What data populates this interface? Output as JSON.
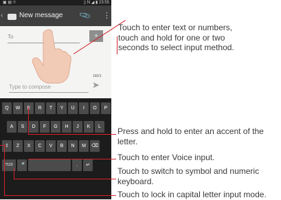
{
  "status_bar": {
    "left_icons": "▣ ▤ ⟐",
    "right_text": "▯ N ◢ ▮ 23:55"
  },
  "action_bar": {
    "title": "New message",
    "back_glyph": "‹",
    "attach_glyph": "📎",
    "menu_glyph": "⋮",
    "icons": [
      "back-icon",
      "message-icon",
      "attach-icon",
      "overflow-menu-icon"
    ]
  },
  "compose": {
    "to_placeholder": "To",
    "contact_glyph": "+",
    "counter": "160/1",
    "body_placeholder": "Type to compose",
    "send_glyph": "➤"
  },
  "keyboard": {
    "row1": [
      "Q",
      "W",
      "E",
      "R",
      "T",
      "Y",
      "U",
      "I",
      "O",
      "P"
    ],
    "row2": [
      "A",
      "S",
      "D",
      "F",
      "G",
      "H",
      "J",
      "K",
      "L"
    ],
    "row3": [
      "⇧",
      "Z",
      "X",
      "C",
      "V",
      "B",
      "N",
      "M",
      "⌫"
    ],
    "row4": [
      "?123",
      "🎤",
      "",
      ".",
      "↵"
    ]
  },
  "callouts": [
    {
      "id": "text-input",
      "lines": [
        "Touch to enter text or numbers,",
        "touch and hold for one or two",
        "seconds to select input method."
      ]
    },
    {
      "id": "accent",
      "lines": [
        "Press and hold to enter an accent of the",
        "letter."
      ]
    },
    {
      "id": "voice",
      "lines": [
        "Touch to enter Voice input."
      ]
    },
    {
      "id": "symbol",
      "lines": [
        "Touch to switch to symbol and numeric",
        "keyboard."
      ]
    },
    {
      "id": "caps",
      "lines": [
        "Touch to lock in capital letter input mode."
      ]
    }
  ],
  "colors": {
    "callout_line": "#d4232b",
    "keyboard_bg": "#1c1c1c",
    "key_bg": "#4b4b4b",
    "action_bar_bg": "#3f3f3f"
  }
}
